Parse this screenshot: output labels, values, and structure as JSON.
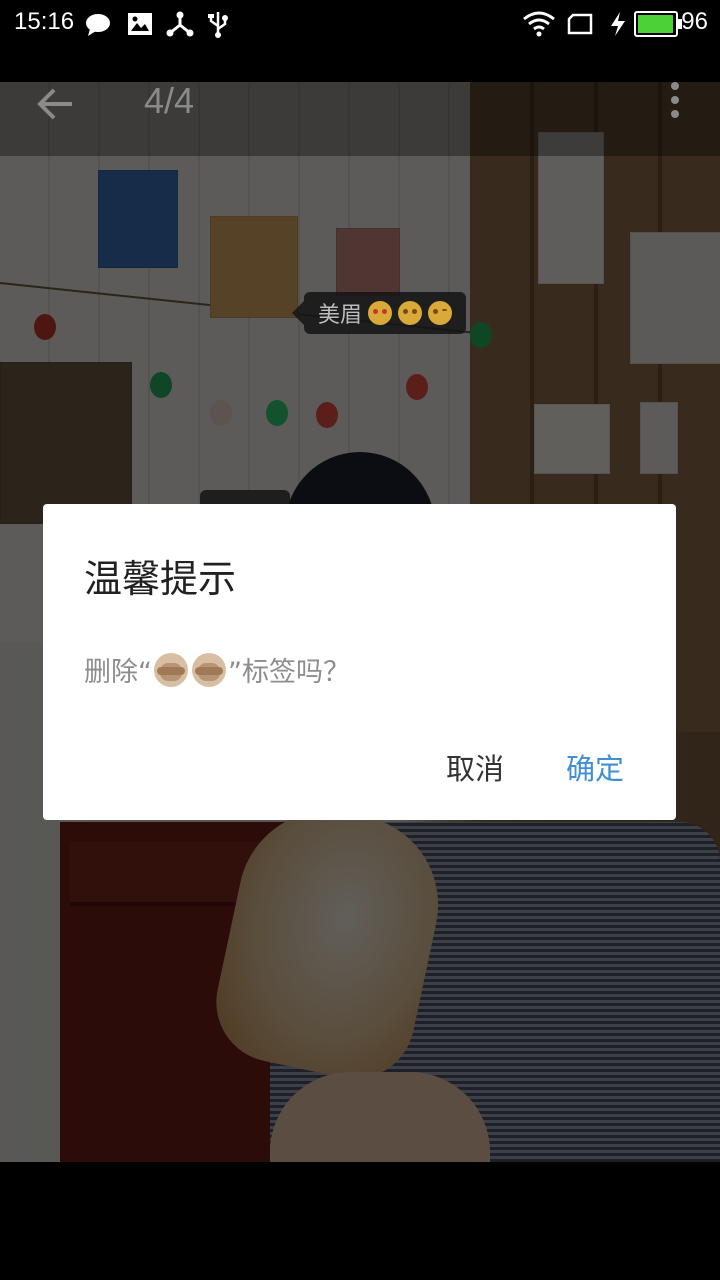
{
  "status_bar": {
    "time": "15:16",
    "left_icons": [
      "chat-bubble-icon",
      "image-icon",
      "share-nodes-icon",
      "usb-icon"
    ],
    "right_icons": [
      "wifi-icon",
      "screen-icon",
      "charging-bolt-icon",
      "battery-icon"
    ],
    "battery_percent": "96",
    "battery_color": "#4cd137"
  },
  "toolbar": {
    "counter": "4/4",
    "back_icon": "arrow-left-icon",
    "more_icon": "more-vertical-icon"
  },
  "photo_tag": {
    "label": "美眉",
    "emojis": [
      "heart-eyes-emoji",
      "relieved-emoji",
      "wink-emoji"
    ]
  },
  "dialog": {
    "title": "温馨提示",
    "message_prefix": "删除“",
    "message_emojis": [
      "see-no-evil-monkey-emoji",
      "see-no-evil-monkey-emoji"
    ],
    "message_suffix": "”标签吗？",
    "cancel_label": "取消",
    "confirm_label": "确定",
    "confirm_color": "#3f8fd2"
  }
}
